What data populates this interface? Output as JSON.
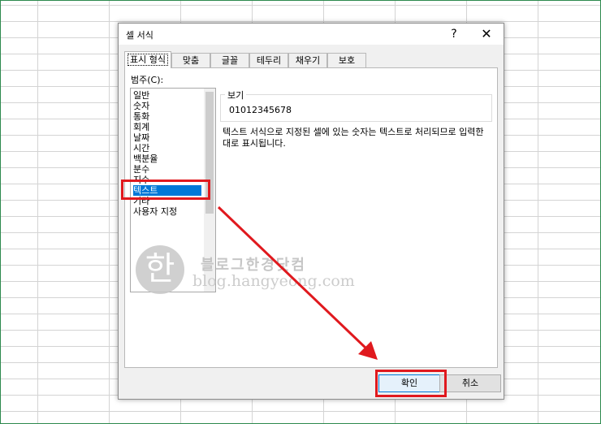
{
  "dialog": {
    "title": "셀 서식",
    "help_label": "?",
    "close_label": "✕"
  },
  "tabs": [
    {
      "label": "표시 형식",
      "active": true
    },
    {
      "label": "맞춤"
    },
    {
      "label": "글꼴"
    },
    {
      "label": "테두리"
    },
    {
      "label": "채우기"
    },
    {
      "label": "보호"
    }
  ],
  "category": {
    "label": "범주(C):",
    "items": [
      "일반",
      "숫자",
      "통화",
      "회계",
      "날짜",
      "시간",
      "백분율",
      "분수",
      "지수",
      "텍스트",
      "기타",
      "사용자 지정"
    ],
    "selected": "텍스트"
  },
  "sample": {
    "legend": "보기",
    "value": "01012345678"
  },
  "description": "텍스트 서식으로 지정된 셀에 있는 숫자는 텍스트로 처리되므로 입력한\n대로 표시됩니다.",
  "buttons": {
    "ok": "확인",
    "cancel": "취소"
  },
  "watermark": {
    "logo_char": "한",
    "title": "블로그한경닷컴",
    "url": "blog.hangyeong.com"
  },
  "annotation_color": "#e0191e",
  "selection_color": "#0078d7"
}
